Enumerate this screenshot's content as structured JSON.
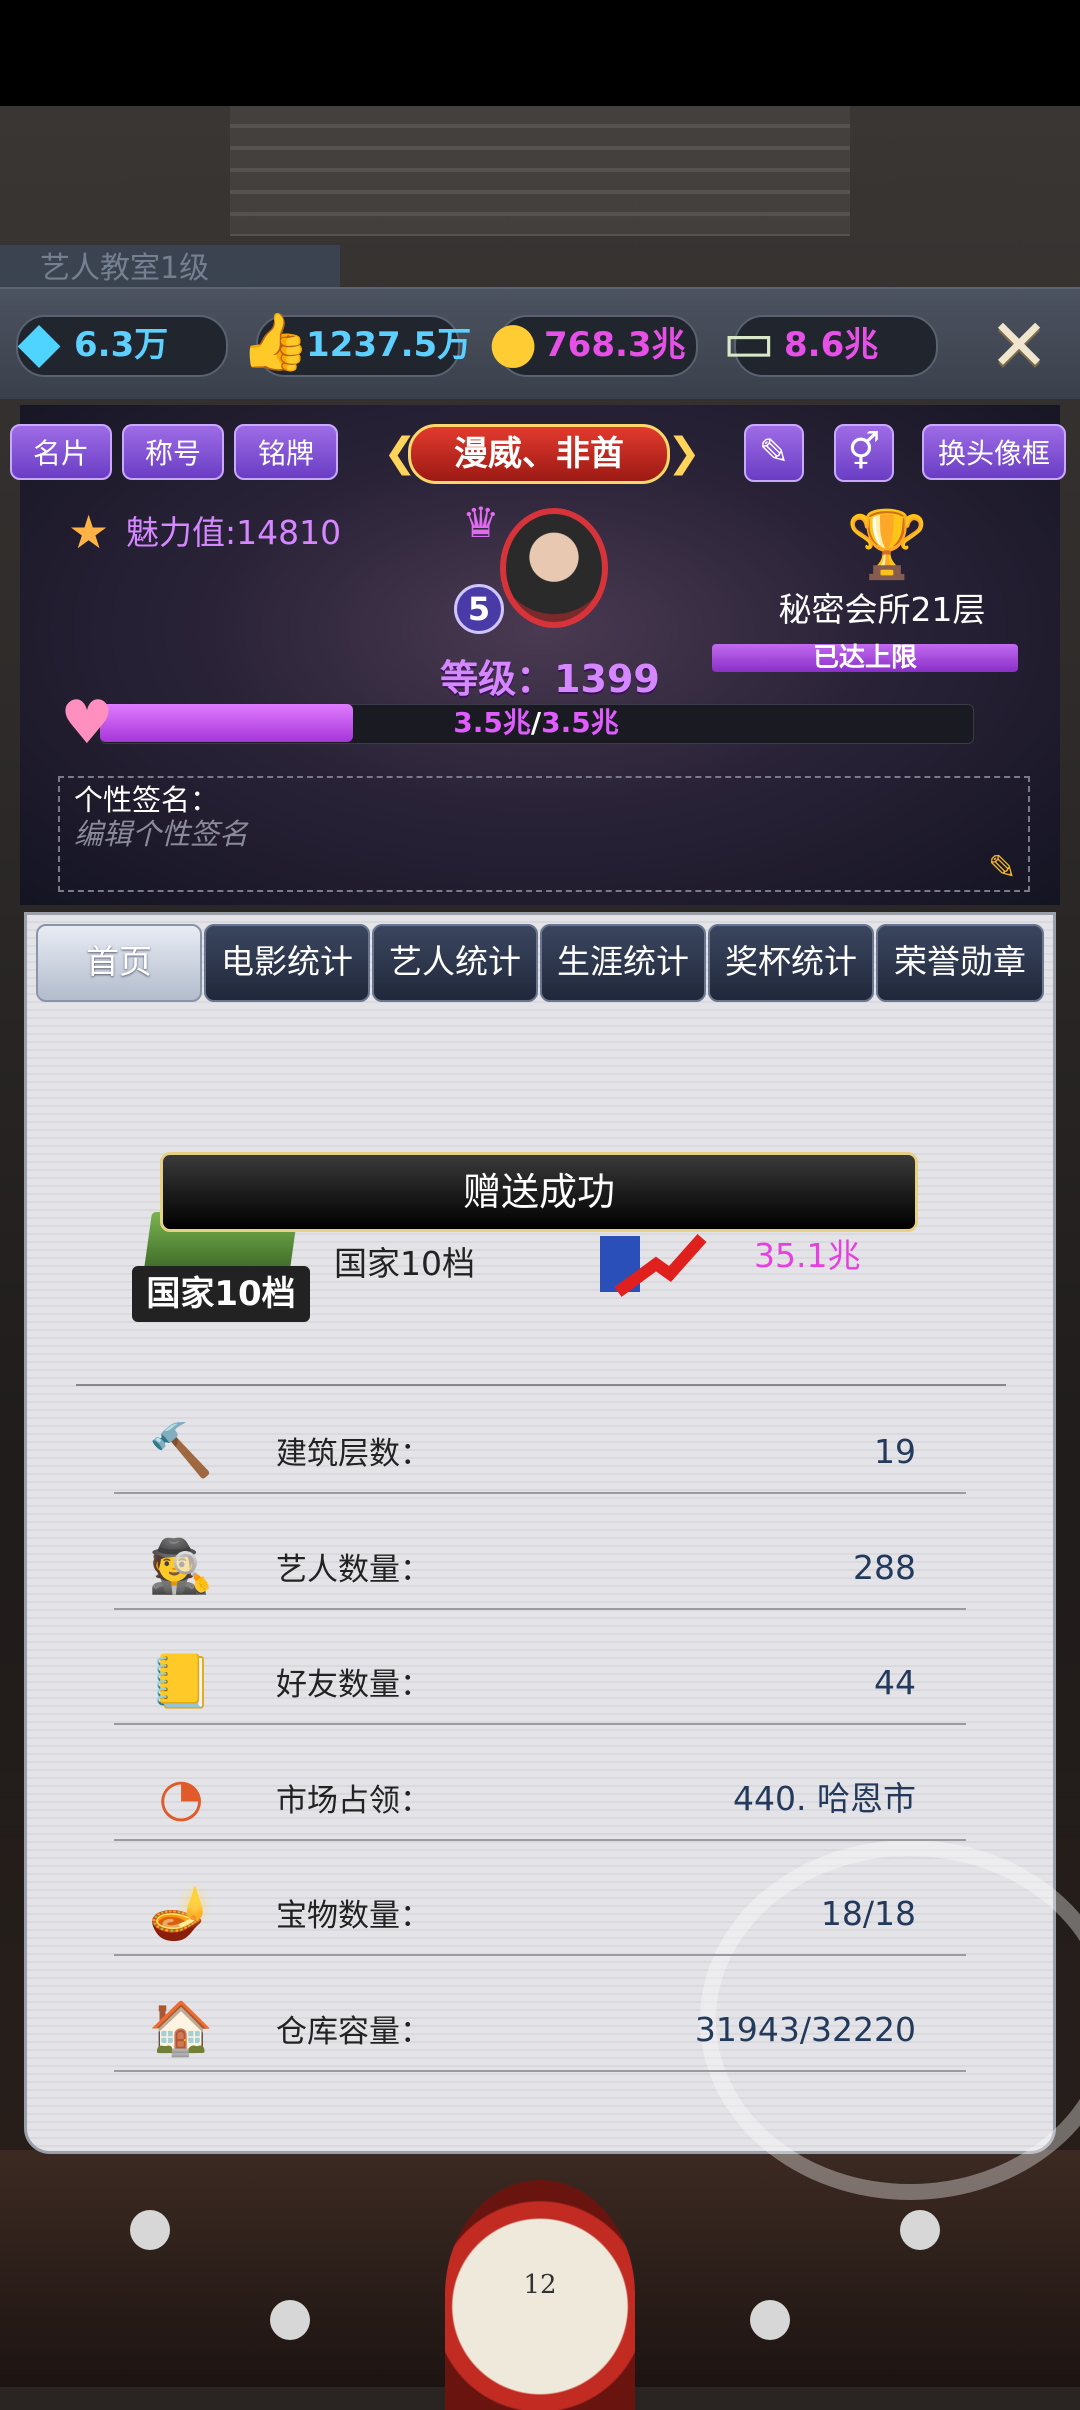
{
  "currency": {
    "diamond": {
      "icon": "diamond-icon",
      "value": "6.3万"
    },
    "likes": {
      "icon": "thumbs-up-icon",
      "value": "1237.5万"
    },
    "gold": {
      "icon": "gold-coins-icon",
      "value": "768.3兆"
    },
    "cash": {
      "icon": "cash-icon",
      "value": "8.6兆"
    }
  },
  "profile": {
    "buttons": [
      "名片",
      "称号",
      "铭牌"
    ],
    "name": "漫威、非酋",
    "frame_button": "换头像框",
    "charm_label": "魅力值:14810",
    "avatar_level": "5",
    "level_text": "等级：1399",
    "club_name": "秘密会所21层",
    "club_status": "已达上限",
    "charm_progress_current": "3.5兆",
    "charm_progress_sep": "/",
    "charm_progress_max": "3.5兆",
    "charm_progress_fraction": 0.29,
    "signature_label": "个性签名：",
    "signature_placeholder": "编辑个性签名"
  },
  "tabs": [
    "首页",
    "电影统计",
    "艺人统计",
    "生涯统计",
    "奖杯统计",
    "荣誉勋章"
  ],
  "active_tab": "首页",
  "toast": "赠送成功",
  "nation": {
    "plate": "国家10档",
    "text": "国家10档"
  },
  "growth_value": "35.1兆",
  "stats": [
    {
      "icon": "hammer-icon",
      "label": "建筑层数：",
      "value": "19"
    },
    {
      "icon": "agent-icon",
      "label": "艺人数量：",
      "value": "288"
    },
    {
      "icon": "address-book-icon",
      "label": "好友数量：",
      "value": "44"
    },
    {
      "icon": "pie-chart-icon",
      "label": "市场占领：",
      "value": "440. 哈恩市"
    },
    {
      "icon": "magic-lamp-icon",
      "label": "宝物数量：",
      "value": "18/18"
    },
    {
      "icon": "warehouse-icon",
      "label": "仓库容量：",
      "value": "31943/32220"
    }
  ],
  "colors": {
    "accent_purple": "#a06ae8",
    "charm_pink": "#d487ff",
    "value_blue": "#233a5c",
    "growth_pink": "#e640e0"
  }
}
